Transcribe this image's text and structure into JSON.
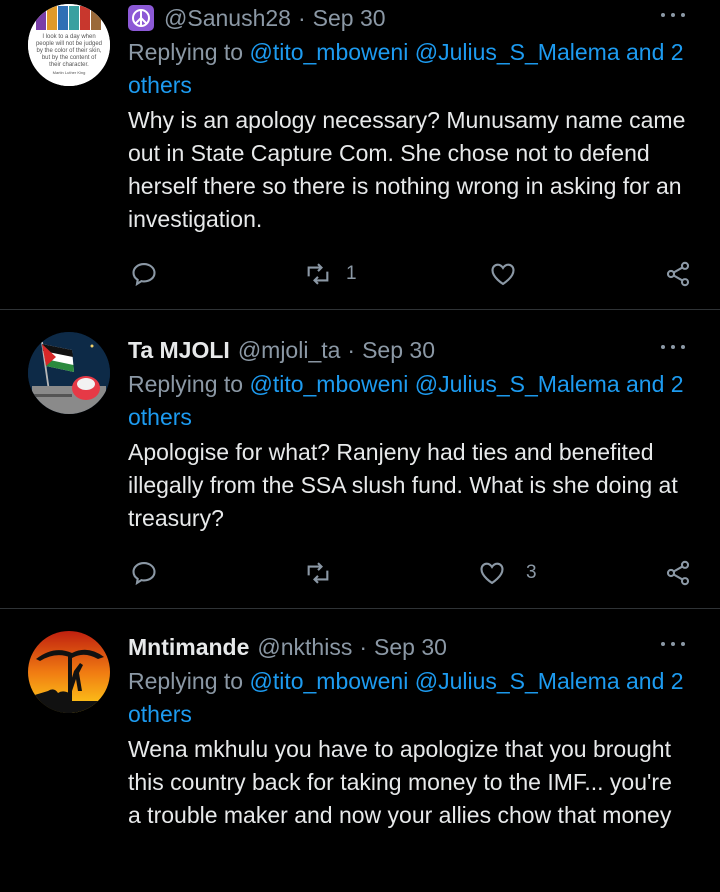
{
  "tweets": [
    {
      "name": "",
      "handle": "@Sanush28",
      "date": "Sep 30",
      "reply_prefix": "Replying to",
      "mention1": "@tito_mboweni",
      "mention2": "@Julius_S_Malema",
      "and_text": "and",
      "others": "2 others",
      "body": "Why is an apology necessary? Munusamy name came out in State Capture Com. She chose not to defend herself there so there is nothing wrong in asking for an investigation.",
      "retweets": "1",
      "likes": "",
      "avatar_text": "I look to a day when people will not be judged by the color of their skin, but by the content of their character. Martin Luther King"
    },
    {
      "name": "Ta MJOLI",
      "handle": "@mjoli_ta",
      "date": "Sep 30",
      "reply_prefix": "Replying to",
      "mention1": "@tito_mboweni",
      "mention2": "@Julius_S_Malema",
      "and_text": "and",
      "others": "2 others",
      "body": "Apologise for what? Ranjeny had ties and benefited illegally from the SSA slush fund. What is she doing at treasury?",
      "retweets": "",
      "likes": "3"
    },
    {
      "name": "Mntimande",
      "handle": "@nkthiss",
      "date": "Sep 30",
      "reply_prefix": "Replying to",
      "mention1": "@tito_mboweni",
      "mention2": "@Julius_S_Malema",
      "and_text": "and",
      "others": "2 others",
      "body": "Wena mkhulu you have to apologize that you brought this country back for taking money to the IMF... you're a trouble maker and now your allies chow that money",
      "retweets": "",
      "likes": ""
    }
  ],
  "icons": {
    "reply": "reply-icon",
    "retweet": "retweet-icon",
    "like": "heart-icon",
    "share": "share-icon",
    "more": "more-options-icon",
    "peace": "peace-symbol-icon"
  },
  "colors": {
    "background": "#000000",
    "text": "#e7e9ea",
    "secondary": "#8b98a5",
    "link": "#1d9bf0",
    "divider": "#2f3336",
    "peace_badge": "#8c59d6"
  }
}
